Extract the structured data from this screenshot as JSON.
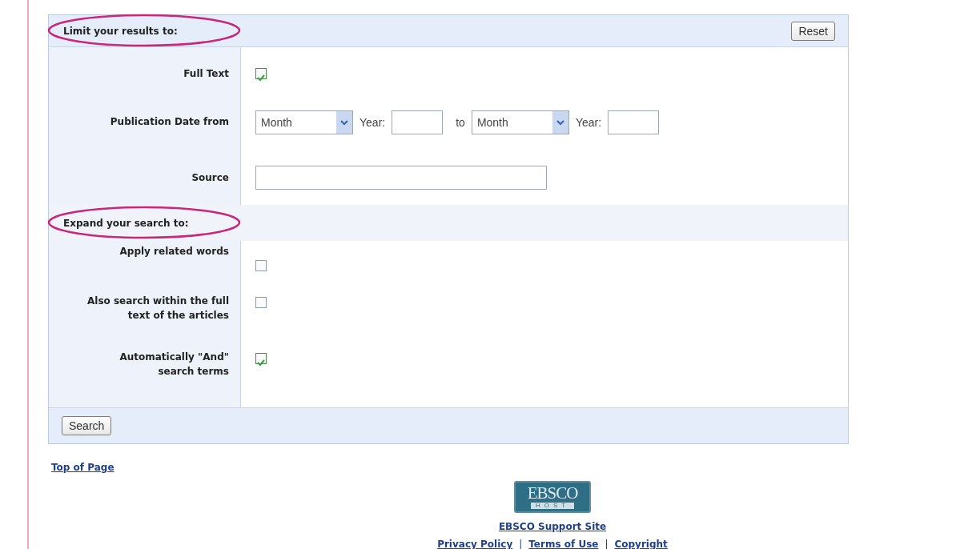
{
  "sections": [
    {
      "heading": "Limit your results to:",
      "circled": true,
      "button": "Reset",
      "rows": [
        {
          "kind": "checkbox",
          "label": "Full Text",
          "checked": true
        },
        {
          "kind": "date_range",
          "label": "Publication Date from",
          "from_month": "Month",
          "from_year_label": "Year:",
          "to_label": "to",
          "to_month": "Month",
          "to_year_label": "Year:"
        },
        {
          "kind": "text",
          "label": "Source"
        }
      ]
    },
    {
      "heading": "Expand your search to:",
      "circled": true,
      "rows": [
        {
          "kind": "checkbox",
          "label": "Apply related words",
          "checked": false
        },
        {
          "kind": "checkbox",
          "label": "Also search within the full text of the articles",
          "checked": false
        },
        {
          "kind": "checkbox",
          "label": "Automatically \"And\" search terms",
          "checked": true
        }
      ]
    }
  ],
  "search_button": "Search",
  "top_link": "Top of Page",
  "logo": {
    "top": "EBSCO",
    "bottom": "HOST"
  },
  "support_link": "EBSCO Support Site",
  "footer_links": [
    "Privacy Policy",
    "Terms of Use",
    "Copyright"
  ],
  "separator": "|"
}
